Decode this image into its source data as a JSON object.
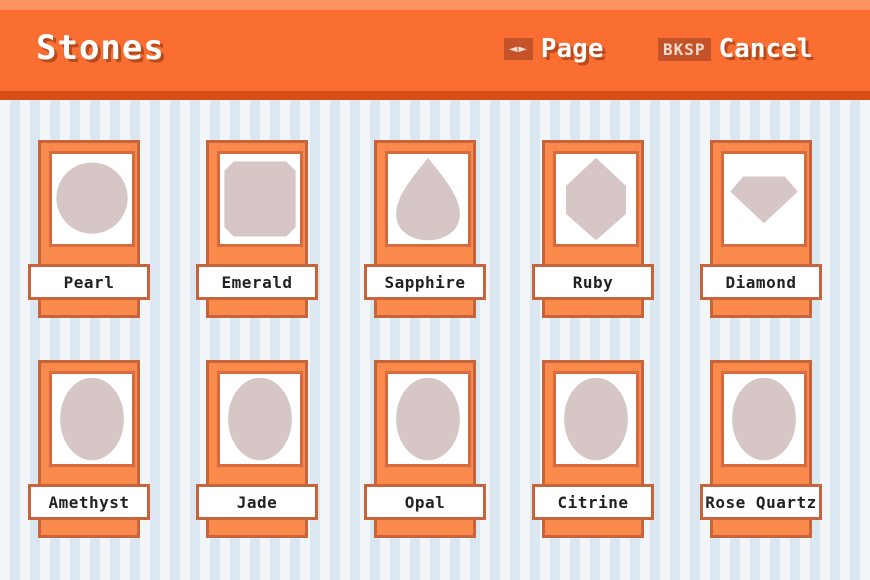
{
  "header": {
    "title": "Stones",
    "page_hint": {
      "key": "◄►",
      "label": "Page"
    },
    "cancel_hint": {
      "key": "BKSP",
      "label": "Cancel"
    }
  },
  "colors": {
    "accent": "#fb6e32",
    "gem": "#d6c6c6"
  },
  "stones": [
    {
      "name": "Pearl",
      "shape": "circle"
    },
    {
      "name": "Emerald",
      "shape": "octagon"
    },
    {
      "name": "Sapphire",
      "shape": "teardrop"
    },
    {
      "name": "Ruby",
      "shape": "hexagon"
    },
    {
      "name": "Diamond",
      "shape": "diamond"
    },
    {
      "name": "Amethyst",
      "shape": "oval"
    },
    {
      "name": "Jade",
      "shape": "oval"
    },
    {
      "name": "Opal",
      "shape": "oval"
    },
    {
      "name": "Citrine",
      "shape": "oval"
    },
    {
      "name": "Rose Quartz",
      "shape": "oval"
    }
  ]
}
